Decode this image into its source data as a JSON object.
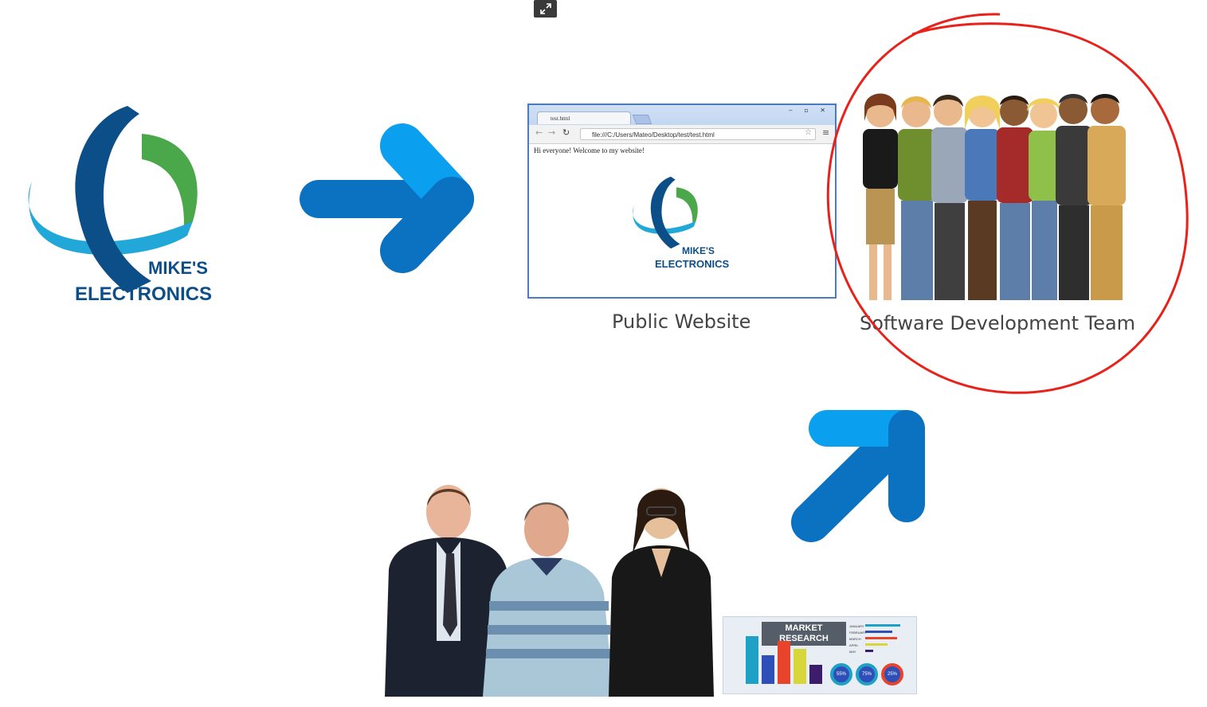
{
  "diagram": {
    "company_logo": {
      "line1": "MIKE'S",
      "line2": "ELECTRONICS"
    },
    "public_website": {
      "caption": "Public Website",
      "browser": {
        "tab_title": "test.html",
        "url": "file:///C:/Users/Mateo/Desktop/test/test.html",
        "content_text": "Hi everyone! Welcome to my website!",
        "logo_line1": "MIKE'S",
        "logo_line2": "ELECTRONICS"
      }
    },
    "software_team": {
      "caption": "Software Development Team",
      "highlight_color": "#e8221b"
    },
    "market_research": {
      "title_line1": "MARKET",
      "title_line2": "RESEARCH",
      "legend": [
        "JANUARY",
        "FEBRUARY",
        "MARCH",
        "APRIL",
        "MAY"
      ],
      "gauges": [
        "55%",
        "75%",
        "25%"
      ]
    },
    "arrow_color_light": "#0aa0ef",
    "arrow_color_dark": "#0a72c0",
    "logo_colors": {
      "dark_blue": "#0c4e88",
      "light_blue": "#22a8d8",
      "green": "#4aa84a"
    },
    "toolbar": {
      "exit_fullscreen_icon": "exit-fullscreen-icon"
    }
  }
}
